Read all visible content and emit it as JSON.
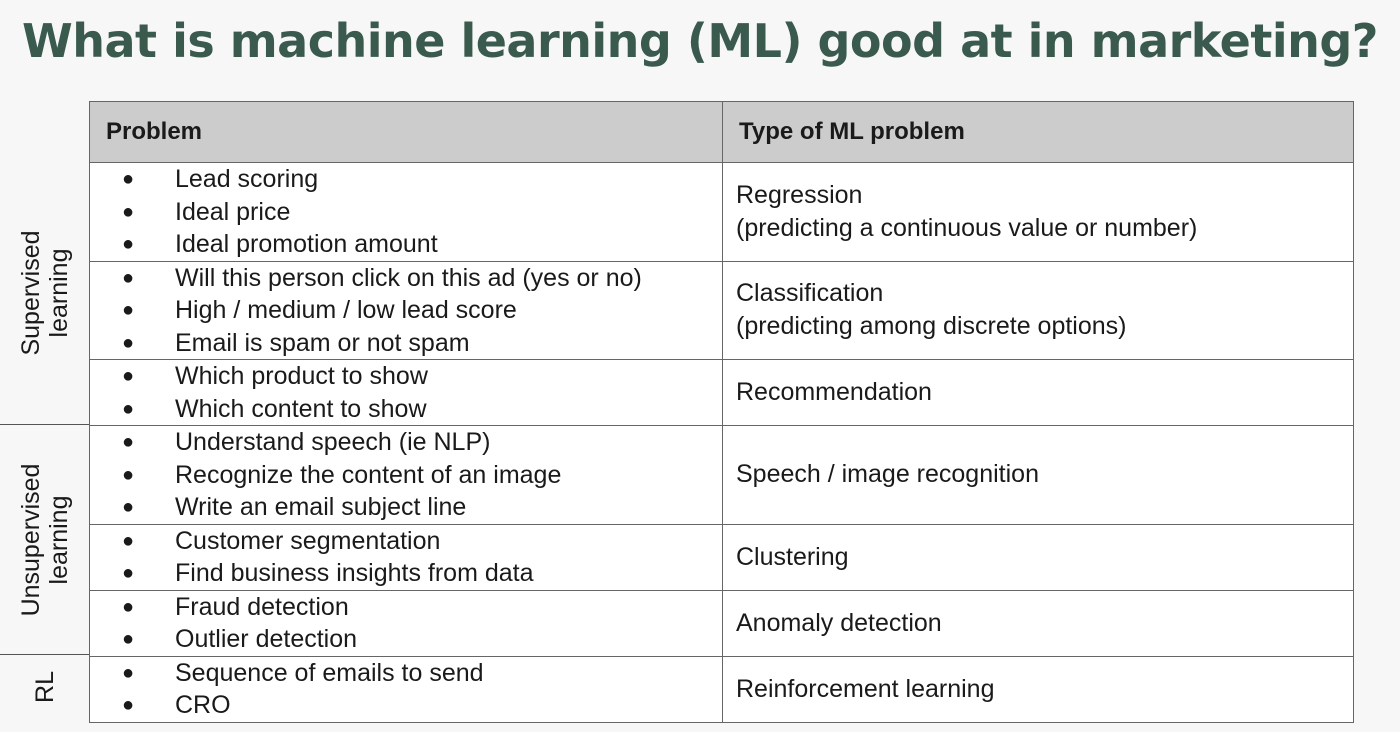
{
  "title": "What is machine learning (ML) good at in marketing?",
  "table": {
    "headers": [
      "Problem",
      "Type of ML problem"
    ],
    "rows": [
      {
        "problems": [
          "Lead scoring",
          "Ideal price",
          "Ideal promotion amount"
        ],
        "type": "Regression",
        "type_detail": "(predicting a continuous value or number)"
      },
      {
        "problems": [
          "Will this person click on this ad (yes or no)",
          "High / medium / low lead score",
          "Email is spam or not spam"
        ],
        "type": "Classification",
        "type_detail": "(predicting among discrete options)"
      },
      {
        "problems": [
          "Which product to show",
          "Which content to show"
        ],
        "type": "Recommendation",
        "type_detail": ""
      },
      {
        "problems": [
          "Understand speech (ie NLP)",
          "Recognize the content of an image",
          "Write an email subject line"
        ],
        "type": "Speech / image recognition",
        "type_detail": ""
      },
      {
        "problems": [
          "Customer segmentation",
          "Find business insights from data"
        ],
        "type": "Clustering",
        "type_detail": ""
      },
      {
        "problems": [
          "Fraud detection",
          "Outlier detection"
        ],
        "type": "Anomaly detection",
        "type_detail": ""
      },
      {
        "problems": [
          "Sequence of emails to send",
          "CRO"
        ],
        "type": "Reinforcement learning",
        "type_detail": ""
      }
    ]
  },
  "groups": [
    {
      "label_line1": "Supervised",
      "label_line2": "learning"
    },
    {
      "label_line1": "Unsupervised",
      "label_line2": "learning"
    },
    {
      "label_line1": "RL",
      "label_line2": ""
    }
  ],
  "bullet_glyph": "●",
  "colors": {
    "title": "#3a5a4e",
    "header_bg": "#cccccc",
    "border": "#666666"
  }
}
